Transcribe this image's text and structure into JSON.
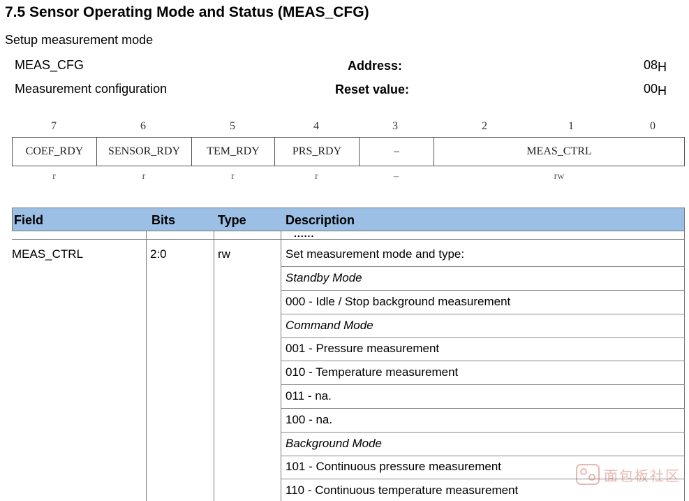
{
  "heading": "7.5  Sensor Operating Mode and Status (MEAS_CFG)",
  "subtitle": "Setup measurement mode",
  "register": {
    "name": "MEAS_CFG",
    "long_name": "Measurement configuration",
    "address_label": "Address:",
    "address_value": "08",
    "address_suffix": "H",
    "reset_label": "Reset value:",
    "reset_value": "00",
    "reset_suffix": "H"
  },
  "bit_numbers": [
    "7",
    "6",
    "5",
    "4",
    "3",
    "2",
    "1",
    "0"
  ],
  "bit_fields": [
    {
      "label": "COEF_RDY",
      "access": "r"
    },
    {
      "label": "SENSOR_RDY",
      "access": "r"
    },
    {
      "label": "TEM_RDY",
      "access": "r"
    },
    {
      "label": "PRS_RDY",
      "access": "r"
    },
    {
      "label": "–",
      "access": "–"
    },
    {
      "label": "MEAS_CTRL",
      "access": "rw"
    }
  ],
  "table": {
    "headers": [
      "Field",
      "Bits",
      "Type",
      "Description"
    ],
    "ellipsis": "......",
    "row": {
      "field": "MEAS_CTRL",
      "bits": "2:0",
      "type": "rw",
      "description": [
        "Set measurement mode and type:",
        "Standby Mode",
        "000 - Idle / Stop background measurement",
        "Command Mode",
        "001 - Pressure measurement",
        "010 - Temperature measurement",
        "011 - na.",
        "100 - na.",
        "Background Mode",
        "101 - Continuous pressure measurement",
        "110 - Continuous temperature measurement"
      ]
    }
  },
  "watermark": "面包板社区"
}
